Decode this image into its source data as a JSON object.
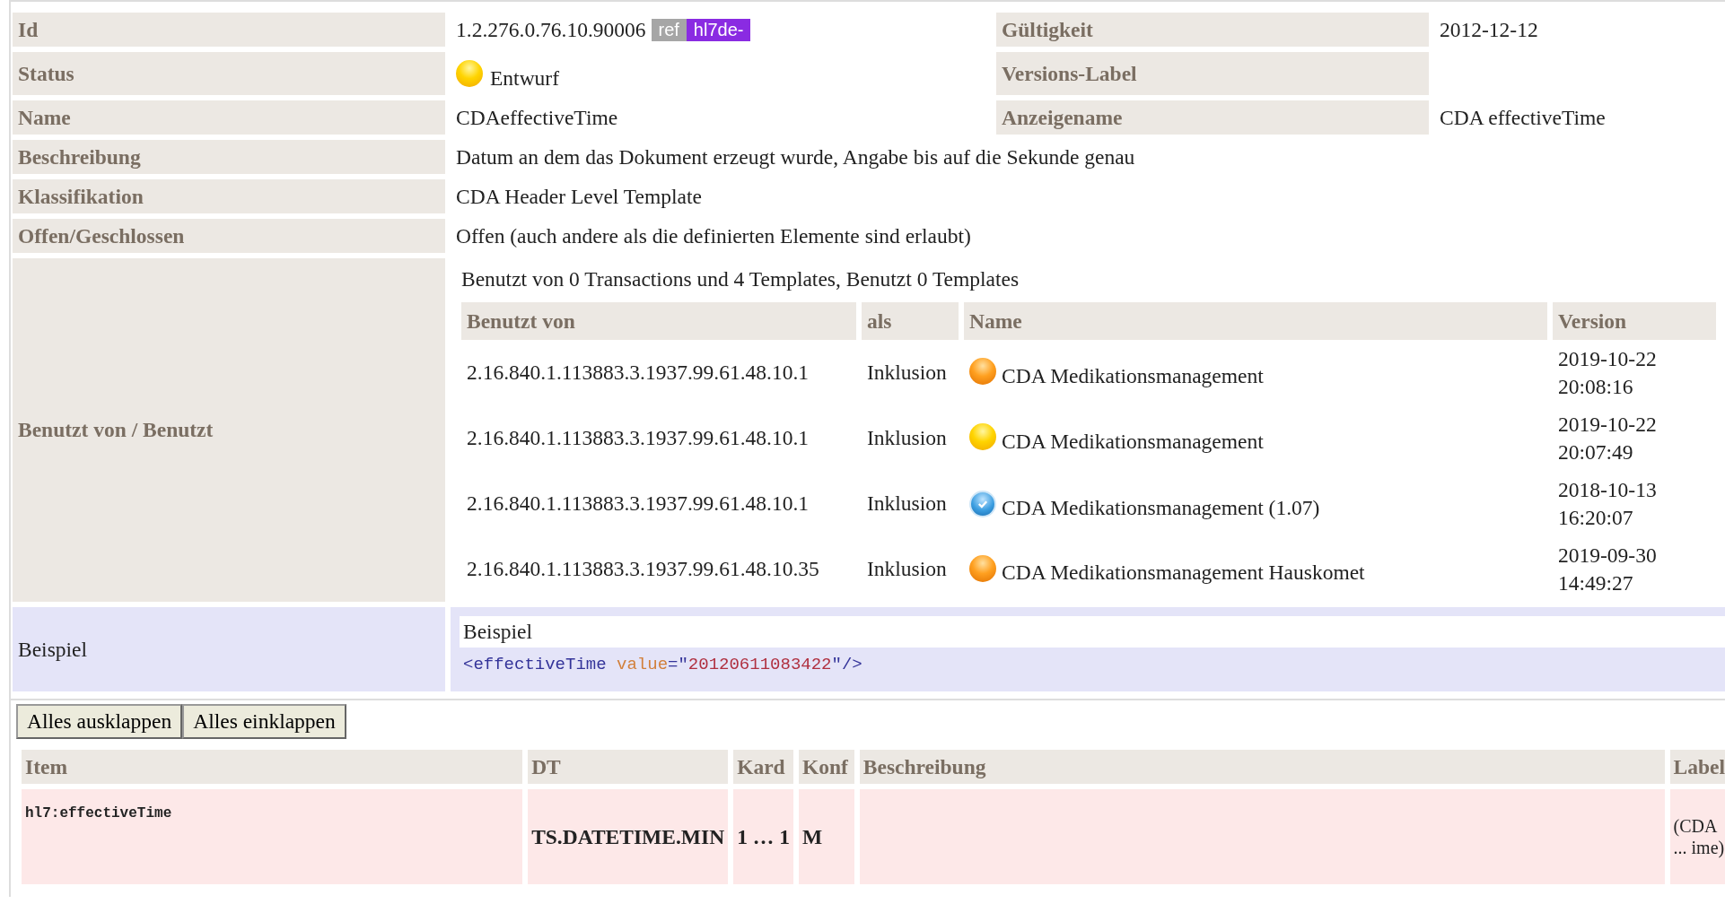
{
  "header": {
    "id": {
      "label": "Id",
      "value": "1.2.276.0.76.10.90006",
      "badges": [
        {
          "kind": "ref",
          "text": "ref"
        },
        {
          "kind": "prefix",
          "text": "hl7de-"
        }
      ]
    },
    "validity": {
      "label": "Gültigkeit",
      "value": "2012-12-12"
    },
    "status": {
      "label": "Status",
      "value": "Entwurf",
      "kind": "draft"
    },
    "version_label": {
      "label": "Versions-Label"
    },
    "name": {
      "label": "Name",
      "value": "CDAeffectiveTime"
    },
    "display_name": {
      "label": "Anzeigename",
      "value": "CDA effectiveTime"
    },
    "wide_rows": [
      {
        "label": "Beschreibung",
        "value": "Datum an dem das Dokument erzeugt wurde, Angabe bis auf die Sekunde genau"
      },
      {
        "label": "Klassifikation",
        "value": "CDA Header Level Template"
      },
      {
        "label": "Offen/Geschlossen",
        "value": "Offen (auch andere als die definierten Elemente sind erlaubt)"
      }
    ]
  },
  "usage": {
    "label": "Benutzt von / Benutzt",
    "summary": "Benutzt von 0 Transactions und 4 Templates, Benutzt 0 Templates",
    "columns": [
      "Benutzt von",
      "als",
      "Name",
      "Version"
    ],
    "rows": [
      {
        "used_by": "2.16.840.1.113883.3.1937.99.61.48.10.1",
        "as": "Inklusion",
        "kind": "pending",
        "name": "CDA Medikationsmanagement",
        "version": "2019-10-22 20:08:16"
      },
      {
        "used_by": "2.16.840.1.113883.3.1937.99.61.48.10.1",
        "as": "Inklusion",
        "kind": "draft",
        "name": "CDA Medikationsmanagement",
        "version": "2019-10-22 20:07:49"
      },
      {
        "used_by": "2.16.840.1.113883.3.1937.99.61.48.10.1",
        "as": "Inklusion",
        "kind": "active",
        "name": "CDA Medikationsmanagement (1.07)",
        "version": "2018-10-13 16:20:07"
      },
      {
        "used_by": "2.16.840.1.113883.3.1937.99.61.48.10.35",
        "as": "Inklusion",
        "kind": "pending",
        "name": "CDA Medikationsmanagement Hauskomet",
        "version": "2019-09-30 14:49:27"
      }
    ]
  },
  "example": {
    "label": "Beispiel",
    "title": "Beispiel",
    "code": [
      {
        "kind": "tag",
        "text": "<effectiveTime "
      },
      {
        "kind": "attr",
        "text": "value"
      },
      {
        "kind": "tag",
        "text": "=\""
      },
      {
        "kind": "value",
        "text": "20120611083422"
      },
      {
        "kind": "tag",
        "text": "\"/>"
      }
    ]
  },
  "buttons": [
    "Alles ausklappen",
    "Alles einklappen"
  ],
  "items": {
    "columns": [
      "Item",
      "DT",
      "Kard",
      "Konf",
      "Beschreibung",
      "Label"
    ],
    "rows": [
      {
        "item": "hl7:effectiveTime",
        "dt": "TS.DATETIME.MIN",
        "card": "1 … 1",
        "conf": "M",
        "label": "(CDA ... ime)"
      }
    ]
  }
}
